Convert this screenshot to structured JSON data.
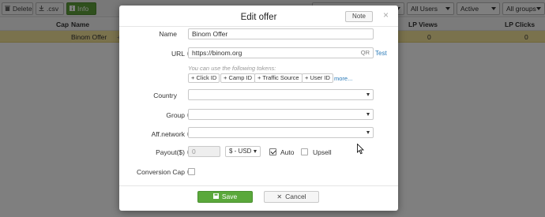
{
  "toolbar": {
    "delete_label": "Delete",
    "csv_label": ".csv",
    "info_label": "Info",
    "filters": [
      {
        "value": ""
      },
      {
        "value": "All Users"
      },
      {
        "value": "Active"
      },
      {
        "value": "All groups"
      }
    ]
  },
  "table": {
    "columns": {
      "cap": "Cap",
      "name": "Name",
      "lp_views": "LP Views",
      "lp_clicks": "LP Clicks"
    },
    "rows": [
      {
        "name": "Binom Offer",
        "lp_views": "0",
        "lp_clicks": "0"
      }
    ]
  },
  "modal": {
    "title": "Edit offer",
    "note_label": "Note",
    "close_label": "×",
    "name": {
      "label": "Name",
      "value": "Binom Offer"
    },
    "url": {
      "label": "URL",
      "value": "https://binom.org",
      "qr_label": "QR",
      "test_label": "Test"
    },
    "tokens_hint": "You can use the following tokens:",
    "tokens": [
      "+ Click ID",
      "+ Camp ID",
      "+ Traffic Source",
      "+ User ID"
    ],
    "more_label": "more...",
    "country": {
      "label": "Country",
      "value": ""
    },
    "group": {
      "label": "Group",
      "value": ""
    },
    "aff_network": {
      "label": "Aff.network",
      "value": ""
    },
    "payout": {
      "label": "Payout($)",
      "placeholder": "0",
      "currency": "$ - USD",
      "auto_label": "Auto",
      "auto_checked": true,
      "upsell_label": "Upsell",
      "upsell_checked": false
    },
    "conversion_cap": {
      "label": "Conversion Cap",
      "checked": false
    },
    "save_label": "Save",
    "cancel_label": "Cancel"
  },
  "colors": {
    "accent_green": "#5aa83b",
    "selected_row": "#f5e49a",
    "link_blue": "#2a7ab8"
  }
}
